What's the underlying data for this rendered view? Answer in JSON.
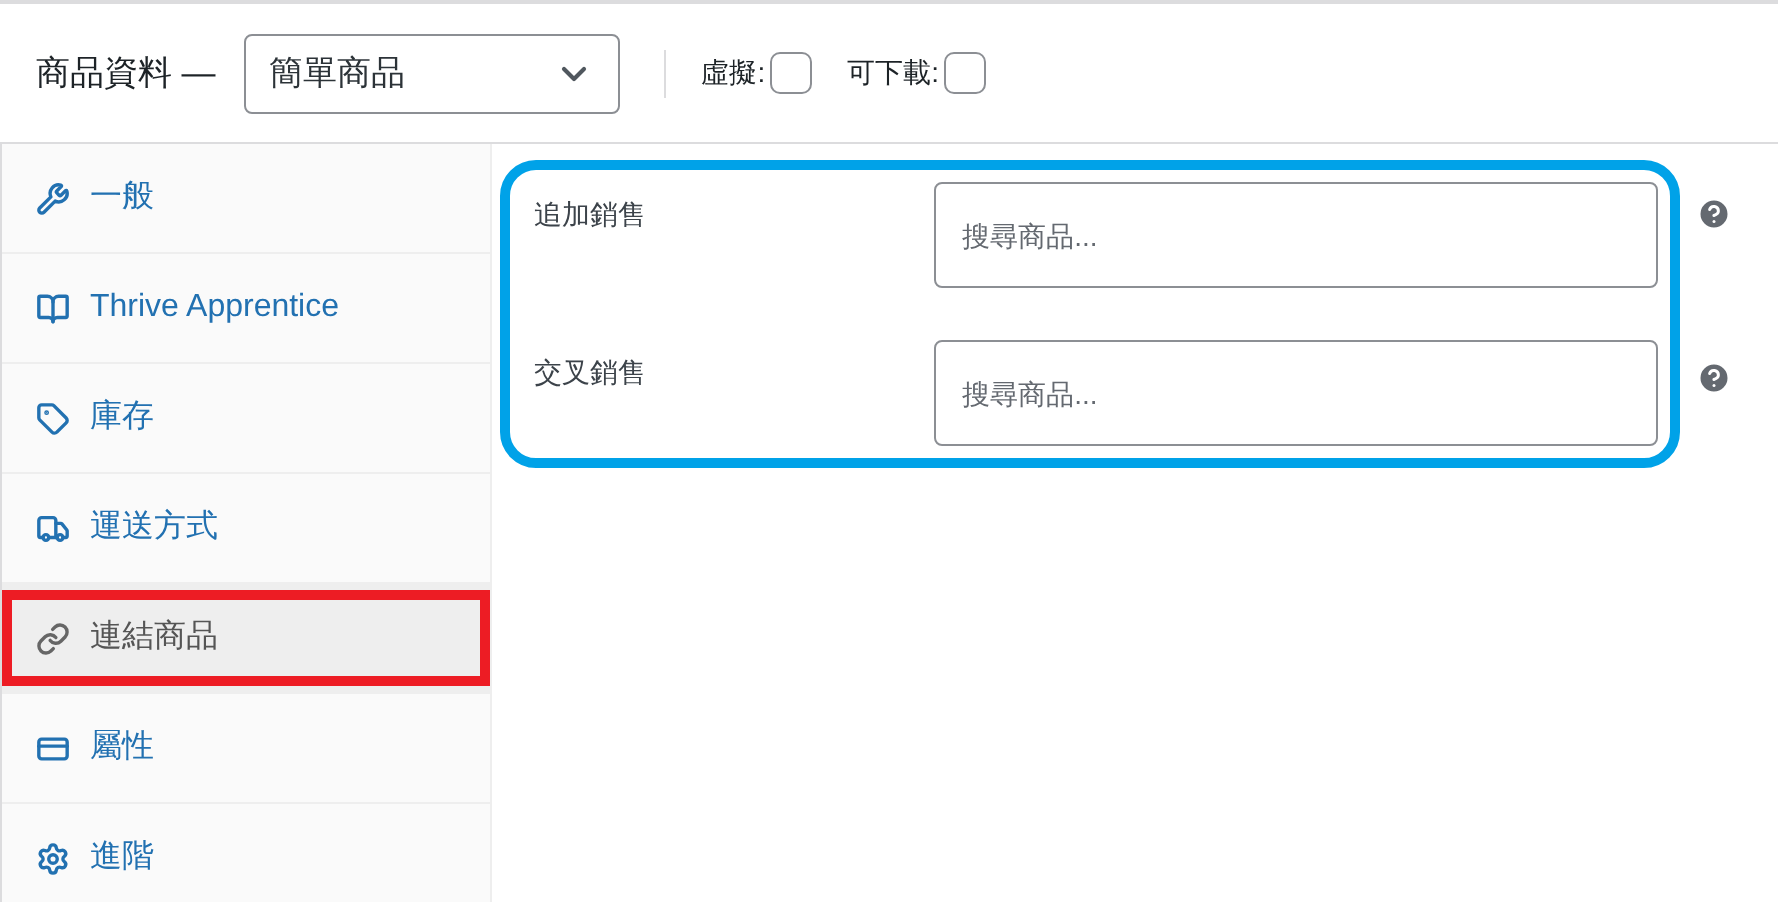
{
  "header": {
    "title": "商品資料 —",
    "product_type": "簡單商品",
    "options": [
      {
        "label": "虛擬:",
        "checked": false
      },
      {
        "label": "可下載:",
        "checked": false
      }
    ]
  },
  "tabs": [
    {
      "label": "一般",
      "selected": false,
      "annotated": false
    },
    {
      "label": "Thrive Apprentice",
      "selected": false,
      "annotated": false
    },
    {
      "label": "庫存",
      "selected": false,
      "annotated": false
    },
    {
      "label": "運送方式",
      "selected": false,
      "annotated": false
    },
    {
      "label": "連結商品",
      "selected": true,
      "annotated": true
    },
    {
      "label": "屬性",
      "selected": false,
      "annotated": false
    },
    {
      "label": "進階",
      "selected": false,
      "annotated": false
    }
  ],
  "fields_panel": {
    "annotated": true,
    "fields": [
      {
        "label": "追加銷售",
        "placeholder": "搜尋商品..."
      },
      {
        "label": "交叉銷售",
        "placeholder": "搜尋商品..."
      }
    ]
  }
}
